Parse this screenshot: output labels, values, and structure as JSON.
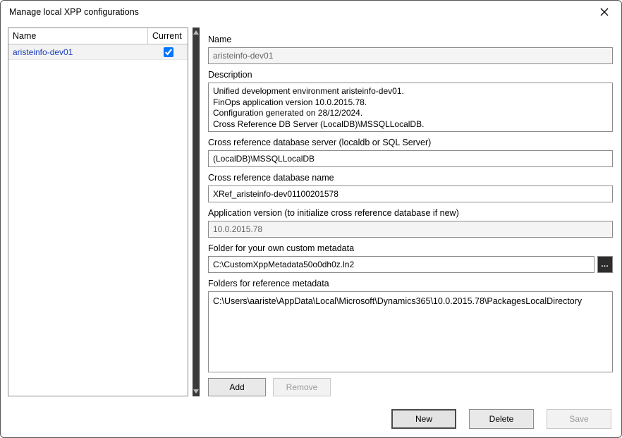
{
  "window": {
    "title": "Manage local XPP configurations"
  },
  "left": {
    "columns": {
      "name": "Name",
      "current": "Current"
    },
    "rows": [
      {
        "name": "aristeinfo-dev01",
        "current": true
      }
    ]
  },
  "form": {
    "name_label": "Name",
    "name_value": "aristeinfo-dev01",
    "description_label": "Description",
    "description_value": "Unified development environment aristeinfo-dev01.\nFinOps application version 10.0.2015.78.\nConfiguration generated on 28/12/2024.\nCross Reference DB Server (LocalDB)\\MSSQLLocalDB.",
    "xref_server_label": "Cross reference database server (localdb or SQL Server)",
    "xref_server_value": "(LocalDB)\\MSSQLLocalDB",
    "xref_db_label": "Cross reference database name",
    "xref_db_value": "XRef_aristeinfo-dev01100201578",
    "app_version_label": "Application version (to initialize cross reference database if new)",
    "app_version_value": "10.0.2015.78",
    "custom_folder_label": "Folder for your own custom metadata",
    "custom_folder_value": "C:\\CustomXppMetadata50o0dh0z.ln2",
    "ref_folders_label": "Folders for reference metadata",
    "ref_folders": [
      "C:\\Users\\aariste\\AppData\\Local\\Microsoft\\Dynamics365\\10.0.2015.78\\PackagesLocalDirectory"
    ],
    "add_label": "Add",
    "remove_label": "Remove"
  },
  "footer": {
    "new_label": "New",
    "delete_label": "Delete",
    "save_label": "Save"
  }
}
